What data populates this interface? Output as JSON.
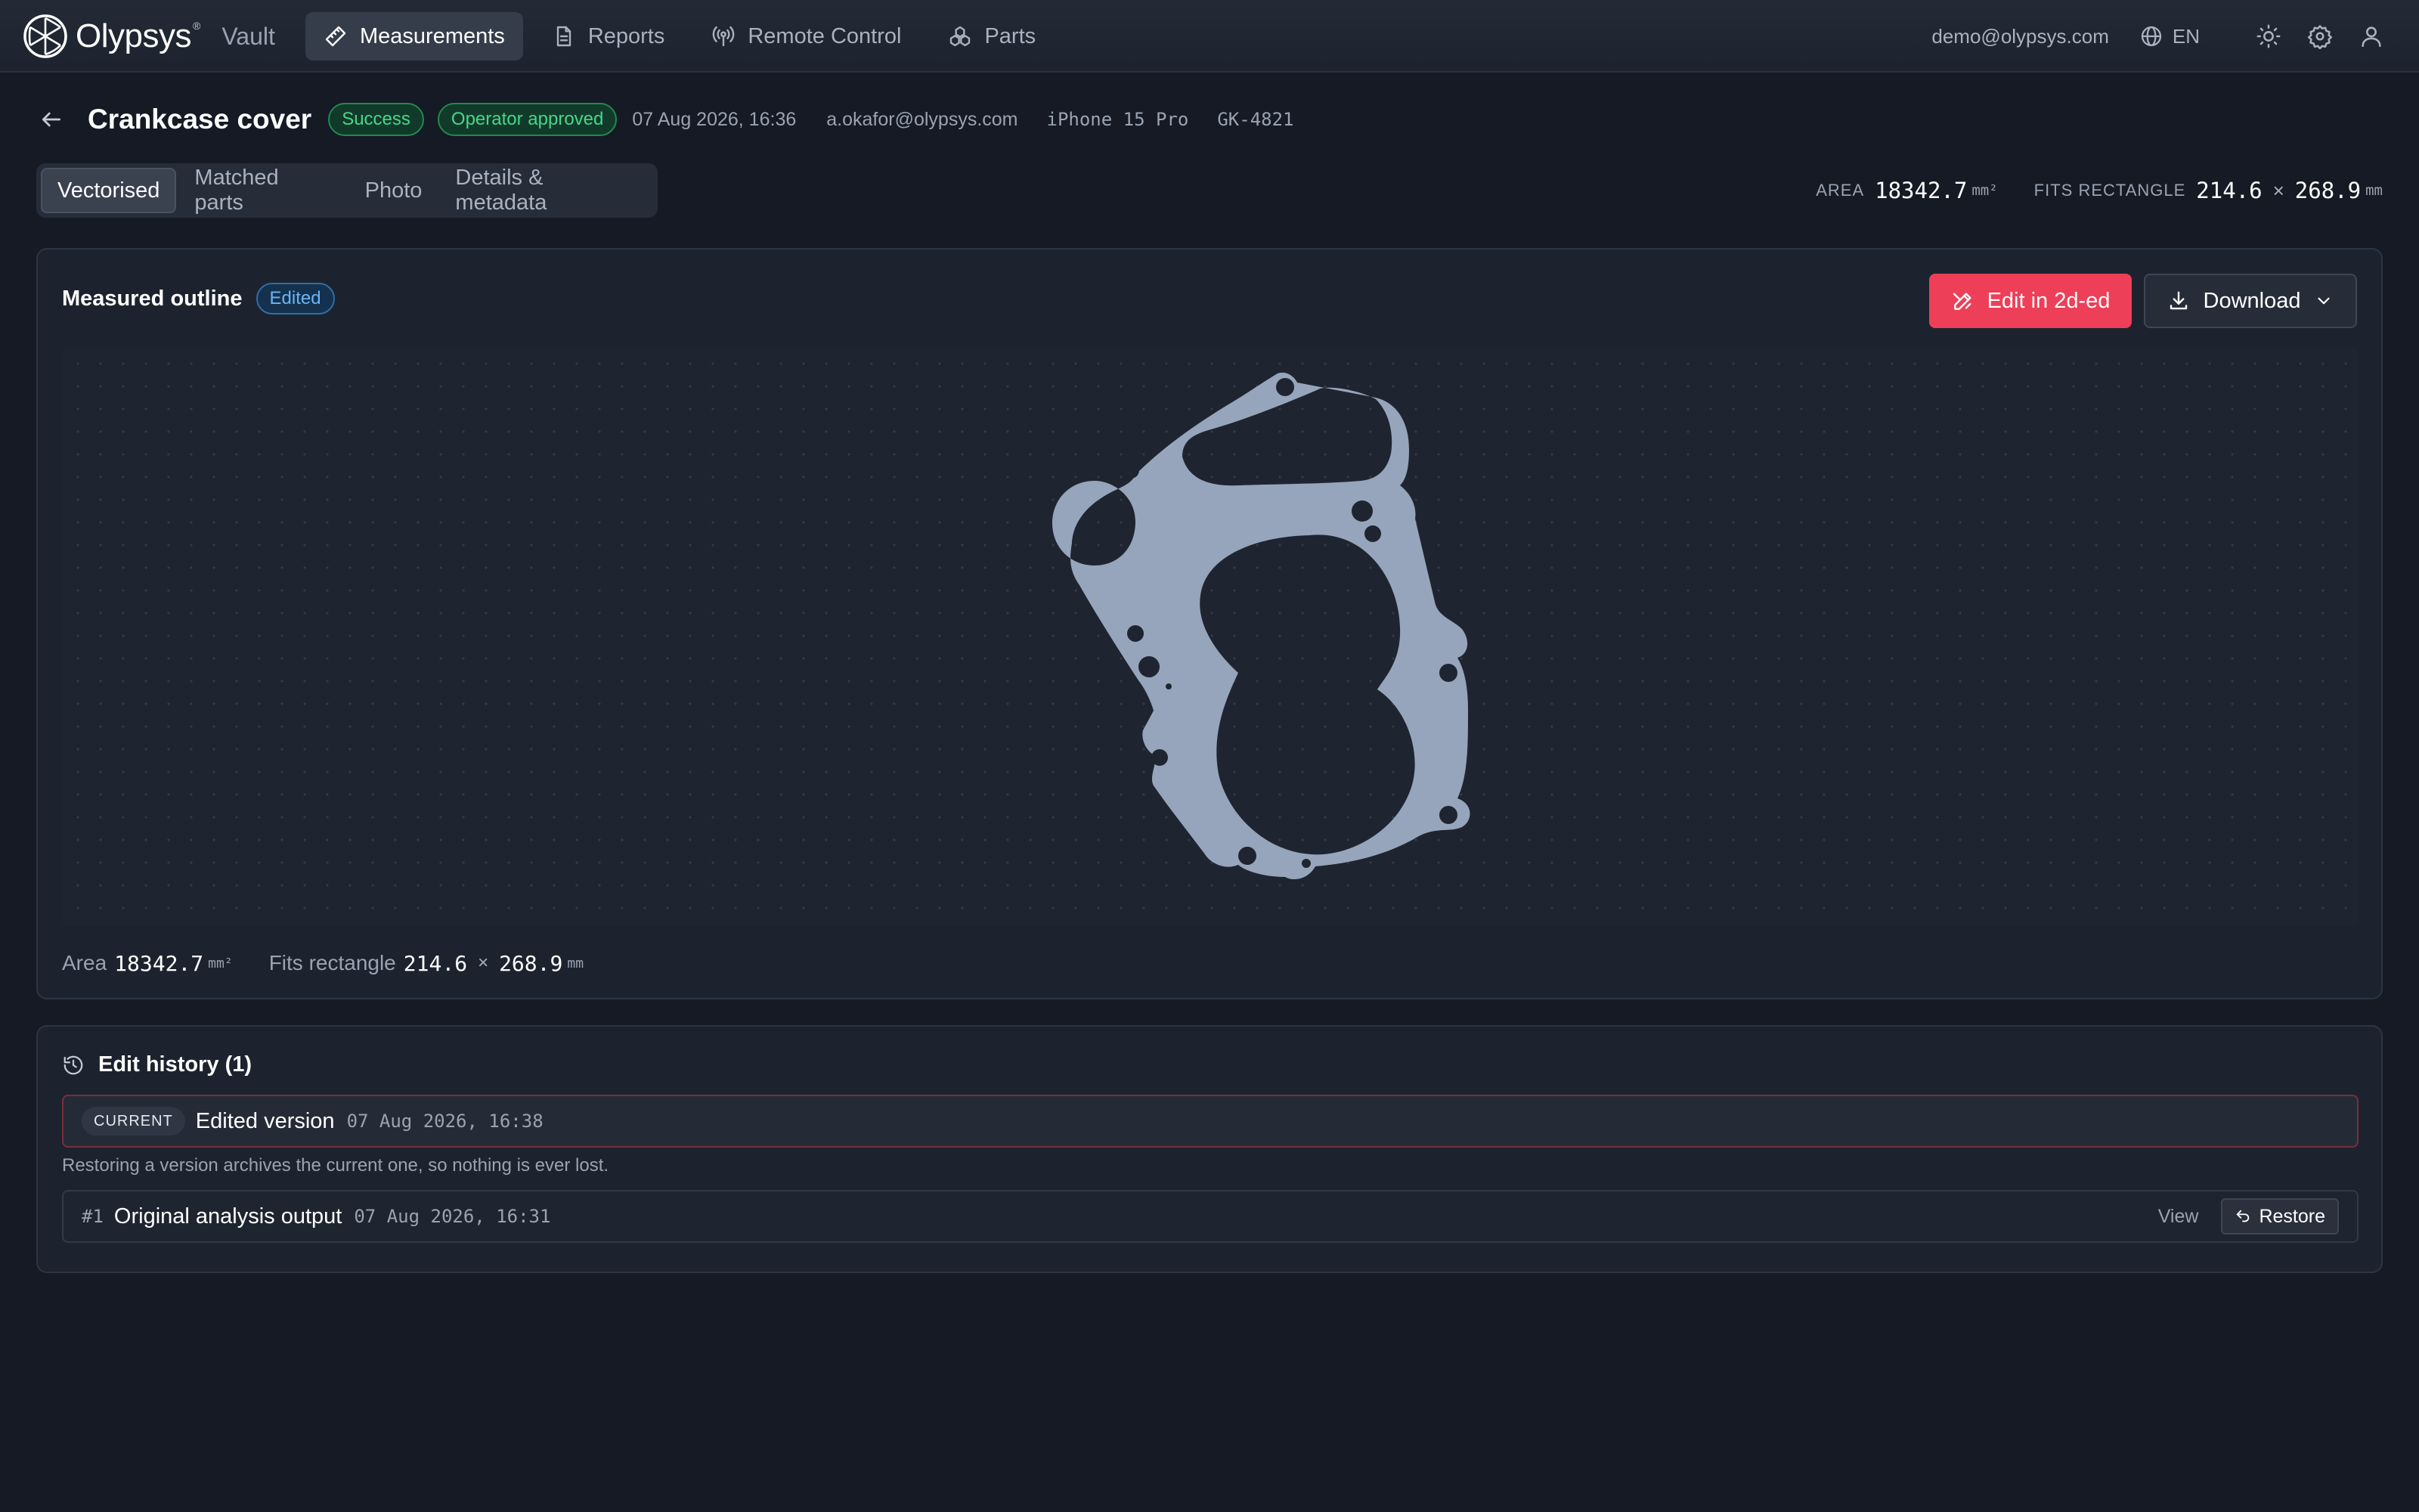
{
  "brand": {
    "name": "Olypsys",
    "tm": "®",
    "product": "Vault"
  },
  "nav": [
    {
      "label": "Measurements",
      "icon": "ruler-icon",
      "active": true
    },
    {
      "label": "Reports",
      "icon": "document-icon"
    },
    {
      "label": "Remote Control",
      "icon": "broadcast-icon"
    },
    {
      "label": "Parts",
      "icon": "parts-icon"
    }
  ],
  "topbar": {
    "email": "demo@olypsys.com",
    "language": "EN"
  },
  "header": {
    "title": "Crankcase cover",
    "status": "Success",
    "approval": "Operator approved",
    "datetime": "07 Aug 2026, 16:36",
    "user": "a.okafor@olypsys.com",
    "device": "iPhone 15 Pro",
    "part_code": "GK-4821"
  },
  "tabs": [
    "Vectorised",
    "Matched parts",
    "Photo",
    "Details & metadata"
  ],
  "summary": {
    "area_label": "AREA",
    "area_value": "18342.7",
    "area_unit": "mm²",
    "fits_label": "FITS RECTANGLE",
    "fits_w": "214.6",
    "times": "×",
    "fits_h": "268.9",
    "fits_unit": "mm"
  },
  "outline": {
    "title": "Measured outline",
    "badge": "Edited",
    "edit_button": "Edit in 2d-ed",
    "download_button": "Download",
    "shape_color": "#96a5bb",
    "foot": {
      "area_label": "Area",
      "area_value": "18342.7",
      "area_unit": "mm²",
      "fits_label": "Fits rectangle",
      "fits_w": "214.6",
      "times": "×",
      "fits_h": "268.9",
      "fits_unit": "mm"
    }
  },
  "history": {
    "title": "Edit history (1)",
    "current": {
      "badge": "CURRENT",
      "name": "Edited version",
      "time": "07 Aug 2026, 16:38"
    },
    "note": "Restoring a version archives the current one, so nothing is ever lost.",
    "versions": [
      {
        "num": "#1",
        "name": "Original analysis output",
        "time": "07 Aug 2026, 16:31",
        "view": "View",
        "restore": "Restore"
      }
    ]
  },
  "colors": {
    "accent": "#ee3f58",
    "success": "#47d78a",
    "info": "#6cb4f4",
    "background": "#151a24"
  }
}
